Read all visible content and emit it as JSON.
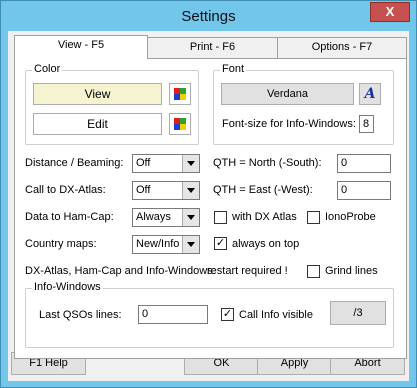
{
  "window": {
    "title": "Settings",
    "close_glyph": "X"
  },
  "tabs": [
    {
      "label": "View - F5",
      "active": true
    },
    {
      "label": "Print - F6",
      "active": false
    },
    {
      "label": "Options - F7",
      "active": false
    }
  ],
  "color_group": {
    "label": "Color",
    "view_label": "View",
    "edit_label": "Edit",
    "view_bg": "#f6f4d0",
    "edit_bg": "#ffffff"
  },
  "font_group": {
    "label": "Font",
    "font_name": "Verdana",
    "font_icon_glyph": "A",
    "size_label": "Font-size for Info-Windows:",
    "size_value": "8"
  },
  "options": {
    "distance_label": "Distance / Beaming:",
    "distance_value": "Off",
    "dxatlas_label": "Call to DX-Atlas:",
    "dxatlas_value": "Off",
    "hamcap_label": "Data to Ham-Cap:",
    "hamcap_value": "Always",
    "country_label": "Country maps:",
    "country_value": "New/Info",
    "qth_north_label": "QTH = North (-South):",
    "qth_north_value": "0",
    "qth_east_label": "QTH = East (-West):",
    "qth_east_value": "0",
    "with_dxatlas_label": "with DX Atlas",
    "with_dxatlas_checked": false,
    "ionoprobe_label": "IonoProbe",
    "ionoprobe_checked": false,
    "always_on_top_label": "always on top",
    "always_on_top_checked": true,
    "restart_text_a": "DX-Atlas, Ham-Cap and Info-Windows:",
    "restart_text_b": "restart required !",
    "grind_lines_label": "Grind lines",
    "grind_lines_checked": false
  },
  "info_windows": {
    "label": "Info-Windows",
    "last_qsos_label": "Last QSOs lines:",
    "last_qsos_value": "0",
    "call_info_label": "Call Info visible",
    "call_info_checked": true,
    "slash3_label": "/3"
  },
  "footer": {
    "help_label": "F1 Help",
    "ok_label": "OK",
    "apply_label": "Apply",
    "abort_label": "Abort"
  },
  "colors": {
    "frame": "#71c6e9",
    "button": "#e1e1e1",
    "font_icon": "#1c2fa8"
  }
}
